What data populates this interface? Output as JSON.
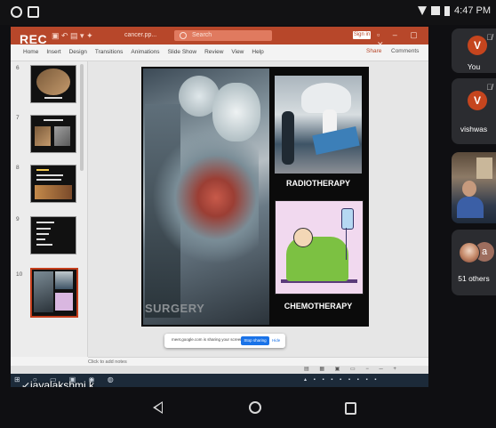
{
  "status_bar": {
    "time": "4:47 PM"
  },
  "meet": {
    "rec_badge": "REC",
    "presenter_name": "jayalakshmi k",
    "sharing_bar": {
      "message": "meet.google.com is sharing your screen.",
      "stop_label": "Stop sharing",
      "hide_label": "Hide"
    },
    "participants": [
      {
        "initial": "V",
        "name": "You"
      },
      {
        "initial": "V",
        "name": "vishwas"
      },
      {
        "initial": "a",
        "name": "51 others"
      }
    ]
  },
  "powerpoint": {
    "doc_title": "cancer.pp...",
    "search_placeholder": "Search",
    "sign_in_label": "Sign in",
    "ribbon_tabs": [
      "Home",
      "Insert",
      "Design",
      "Transitions",
      "Animations",
      "Slide Show",
      "Review",
      "View",
      "Help"
    ],
    "share_label": "Share",
    "comments_label": "Comments",
    "notes_placeholder": "Click to add notes",
    "thumb_numbers": [
      "6",
      "7",
      "8",
      "9",
      "10"
    ],
    "slide": {
      "labels": {
        "surgery": "SURGERY",
        "radiotherapy": "RADIOTHERAPY",
        "chemotherapy": "CHEMOTHERAPY"
      }
    }
  }
}
